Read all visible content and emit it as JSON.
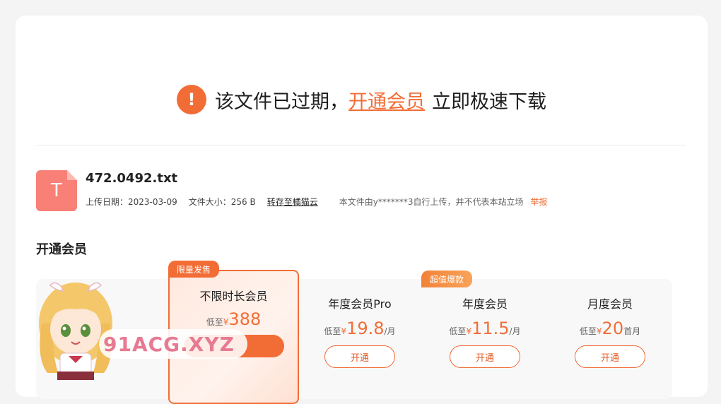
{
  "notice": {
    "prefix": "该文件已过期，",
    "link": "开通会员",
    "suffix": "立即极速下载",
    "icon": "warning-icon"
  },
  "file": {
    "icon_letter": "T",
    "name": "472.0492.txt",
    "upload_date": "上传日期：2023-03-09",
    "size": "文件大小：256 B",
    "save_link": "转存至橘猫云",
    "uploader_note": "本文件由y*******3自行上传，并不代表本站立场",
    "report": "举报"
  },
  "section_title": "开通会员",
  "plans": [
    {
      "tag": "限量发售",
      "name": "不限时长会员",
      "prefix": "低至",
      "currency": "¥",
      "price": "388",
      "unit": ""
    },
    {
      "tag": "",
      "name": "年度会员Pro",
      "prefix": "低至",
      "currency": "¥",
      "price": "19.8",
      "unit": "/月",
      "button": "开通"
    },
    {
      "tag": "超值爆款",
      "name": "年度会员",
      "prefix": "低至",
      "currency": "¥",
      "price": "11.5",
      "unit": "/月",
      "button": "开通"
    },
    {
      "tag": "",
      "name": "月度会员",
      "prefix": "低至",
      "currency": "¥",
      "price": "20",
      "unit": "首月",
      "button": "开通"
    }
  ],
  "watermark": "91ACG.XYZ",
  "colors": {
    "accent": "#f26d36",
    "background": "#f4f4f5"
  }
}
